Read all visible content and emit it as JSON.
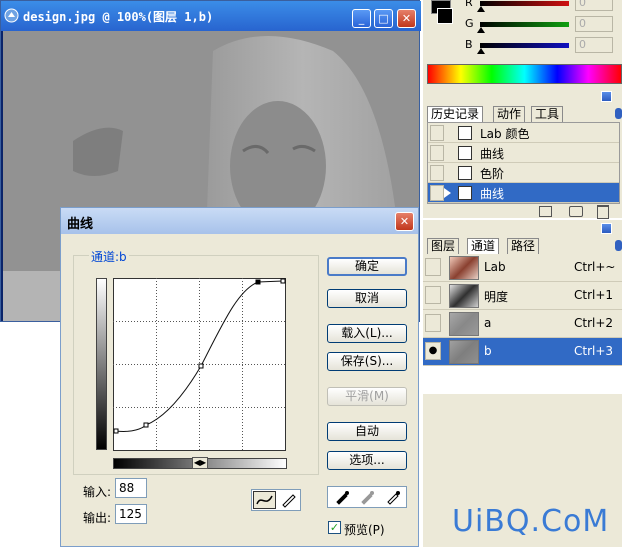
{
  "document_window": {
    "title": "design.jpg @ 100%(图层 1,b)",
    "minimize_label": "_",
    "maximize_label": "□",
    "close_label": "✕"
  },
  "color_panel": {
    "channels": [
      {
        "label": "R",
        "value": "0",
        "color": "#d01010"
      },
      {
        "label": "G",
        "value": "0",
        "color": "#10a010"
      },
      {
        "label": "B",
        "value": "0",
        "color": "#1010c0"
      }
    ]
  },
  "history_panel": {
    "tabs": [
      "历史记录",
      "动作",
      "工具"
    ],
    "items": [
      {
        "label": "Lab 颜色",
        "selected": false
      },
      {
        "label": "曲线",
        "selected": false
      },
      {
        "label": "色阶",
        "selected": false
      },
      {
        "label": "曲线",
        "selected": true
      }
    ]
  },
  "layers_panel": {
    "tabs": [
      "图层",
      "通道",
      "路径"
    ],
    "channels": [
      {
        "name": "Lab",
        "shortcut": "Ctrl+~",
        "visible": false,
        "selected": false
      },
      {
        "name": "明度",
        "shortcut": "Ctrl+1",
        "visible": false,
        "selected": false
      },
      {
        "name": "a",
        "shortcut": "Ctrl+2",
        "visible": false,
        "selected": false
      },
      {
        "name": "b",
        "shortcut": "Ctrl+3",
        "visible": true,
        "selected": true
      }
    ]
  },
  "curves_dialog": {
    "title": "曲线",
    "close_label": "✕",
    "channel_label": "通道:b",
    "buttons": {
      "ok": "确定",
      "cancel": "取消",
      "load": "载入(L)...",
      "save": "保存(S)...",
      "smooth": "平滑(M)",
      "auto": "自动",
      "options": "选项..."
    },
    "input_label": "输入:",
    "input_value": "88",
    "output_label": "输出:",
    "output_value": "125",
    "preview_label": "预览(P)",
    "preview_checked": true
  },
  "watermark": "UiBQ.CoM"
}
